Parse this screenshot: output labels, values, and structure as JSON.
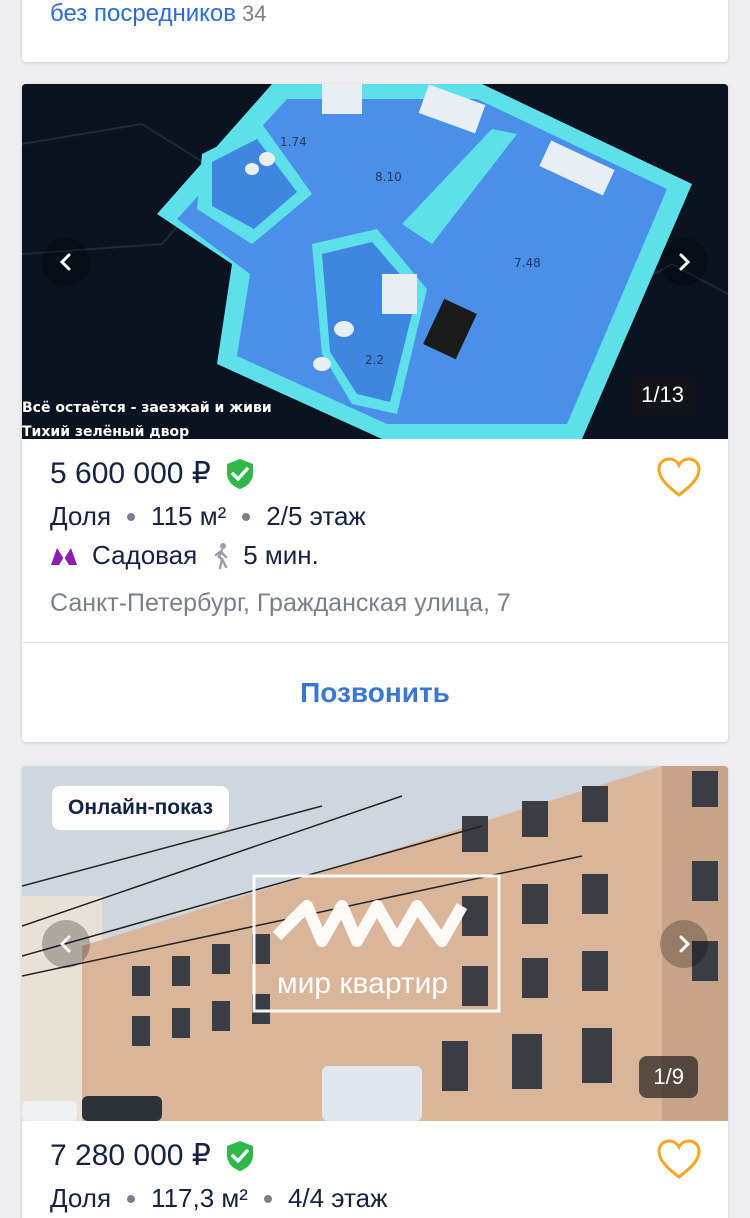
{
  "top_card": {
    "link_text": "без посредников",
    "count": "34"
  },
  "listings": [
    {
      "photo_counter": "1/13",
      "caption_line1": "Всё остаётся - заезжай и живи",
      "caption_line2": "Тихий зелёный двор",
      "plan_labels": [
        "1.74",
        "8.10",
        "7.48",
        "2.2"
      ],
      "price": "5 600 000 ₽",
      "type": "Доля",
      "area": "115 м²",
      "floor": "2/5 этаж",
      "metro_station": "Садовая",
      "metro_time": "5 мин.",
      "address": "Санкт-Петербург, Гражданская улица, 7",
      "call_label": "Позвонить"
    },
    {
      "badge": "Онлайн-показ",
      "photo_counter": "1/9",
      "watermark": "мир квартир",
      "price": "7 280 000 ₽",
      "type": "Доля",
      "area": "117,3 м²",
      "floor": "4/4 этаж"
    }
  ],
  "colors": {
    "background": "#eeeef1",
    "accent_link": "#3a77d4",
    "favorite": "#f5a623",
    "verified": "#2fb84a",
    "metro": "#8a1fb0"
  },
  "icons": {
    "prev": "chevron-left-icon",
    "next": "chevron-right-icon",
    "favorite": "heart-outline-icon",
    "verified": "shield-check-icon",
    "metro": "metro-m-icon",
    "walk": "pedestrian-icon"
  }
}
